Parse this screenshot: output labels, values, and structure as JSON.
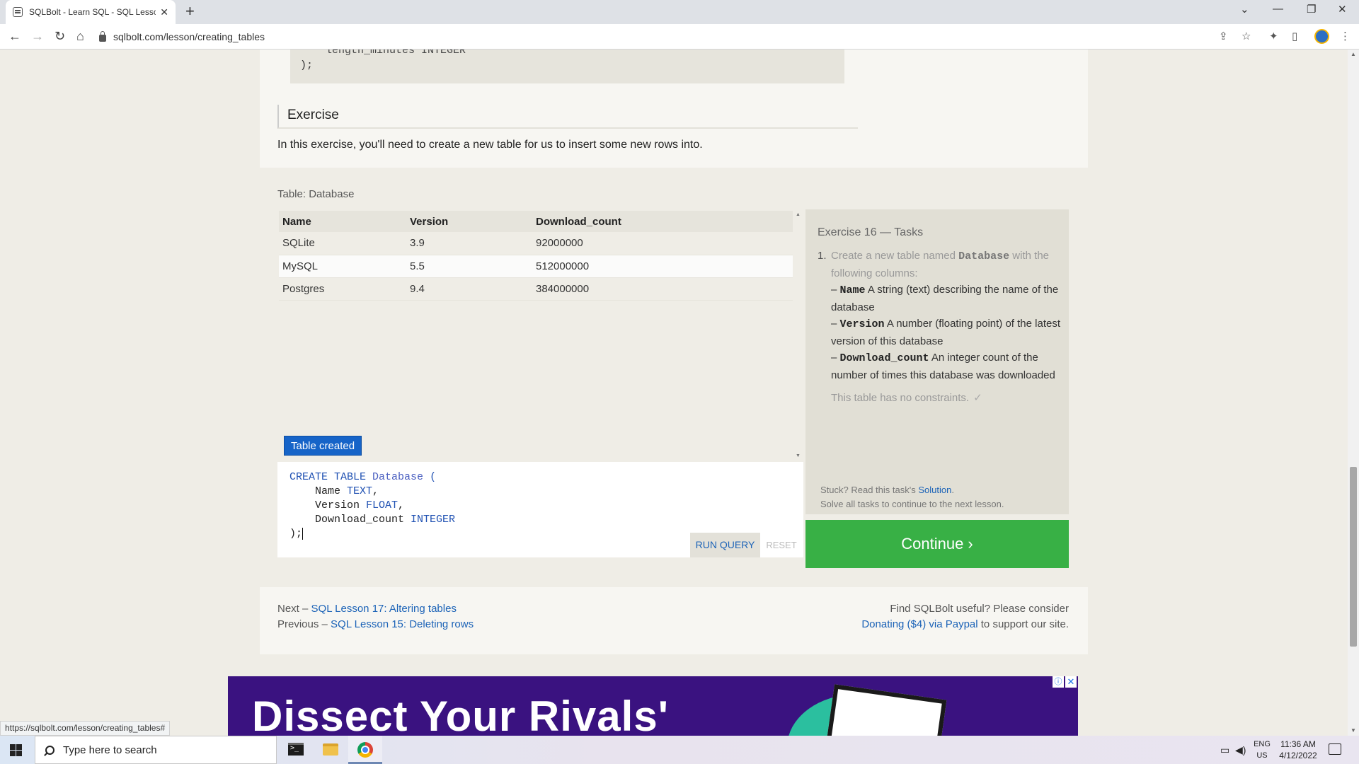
{
  "browser": {
    "tab_title": "SQLBolt - Learn SQL - SQL Lesso",
    "tab_close": "✕",
    "new_tab": "+",
    "url": "sqlbolt.com/lesson/creating_tables",
    "status_url": "https://sqlbolt.com/lesson/creating_tables#",
    "icons": [
      "back-icon",
      "forward-icon",
      "reload-icon",
      "home-icon",
      "lock-icon",
      "share-icon",
      "star-icon",
      "extensions-icon",
      "sidepanel-icon",
      "profile-avatar",
      "menu-icon"
    ]
  },
  "lesson": {
    "code_fragment_top": "length_minutes INTEGER",
    "code_fragment_end": ");",
    "exercise_heading": "Exercise",
    "exercise_description": "In this exercise, you'll need to create a new table for us to insert some new rows into."
  },
  "results": {
    "table_label": "Table: Database",
    "columns": [
      "Name",
      "Version",
      "Download_count"
    ],
    "rows": [
      [
        "SQLite",
        "3.9",
        "92000000"
      ],
      [
        "MySQL",
        "5.5",
        "512000000"
      ],
      [
        "Postgres",
        "9.4",
        "384000000"
      ]
    ],
    "status": "Table created"
  },
  "editor": {
    "run_label": "RUN QUERY",
    "reset_label": "RESET"
  },
  "tasks": {
    "title": "Exercise 16 — Tasks",
    "number": "1.",
    "intro_a": "Create a new table named ",
    "table_name": "Database",
    "intro_b": " with the following columns:",
    "columns": [
      {
        "dash": "– ",
        "name": "Name",
        "desc": " A string (text) describing the name of the database"
      },
      {
        "dash": "– ",
        "name": "Version",
        "desc": " A number (floating point) of the latest version of this database"
      },
      {
        "dash": "– ",
        "name": "Download_count",
        "desc": " An integer count of the number of times this database was downloaded"
      }
    ],
    "constraint": "This table has no constraints.",
    "check": "✓",
    "stuck_prefix": "Stuck? Read this task's ",
    "solution_link": "Solution",
    "stuck_suffix": ".",
    "solve_all": "Solve all tasks to continue to the next lesson.",
    "continue_label": "Continue ›"
  },
  "footer": {
    "next_prefix": "Next – ",
    "next_link": "SQL Lesson 17: Altering tables",
    "prev_prefix": "Previous – ",
    "prev_link": "SQL Lesson 15: Deleting rows",
    "support_line": "Find SQLBolt useful? Please consider",
    "donate_link": "Donating ($4) via Paypal",
    "donate_suffix": " to support our site."
  },
  "ad": {
    "headline": "Dissect Your Rivals'",
    "info": "ⓘ",
    "close": "✕"
  },
  "taskbar": {
    "search_placeholder": "Type here to search",
    "lang_top": "ENG",
    "lang_bottom": "US",
    "time": "11:36 AM",
    "date": "4/12/2022"
  },
  "colors": {
    "continue": "#38b045",
    "link": "#1c63b7",
    "status_badge": "#1664c8",
    "ad_background": "#3a1280"
  }
}
